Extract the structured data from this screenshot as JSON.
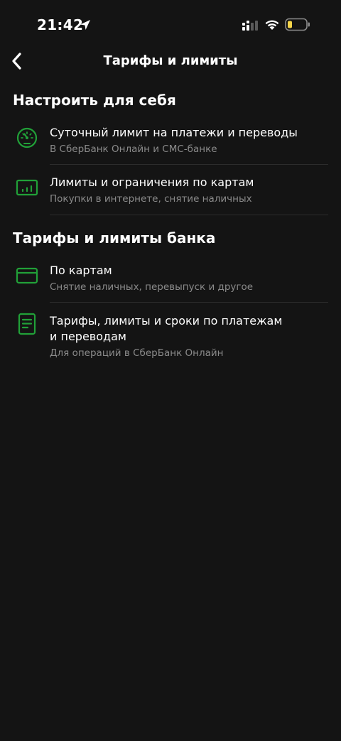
{
  "status_bar": {
    "time": "21:42",
    "icons": [
      "location-arrow-icon",
      "cellular-signal-icon",
      "wifi-icon",
      "battery-icon"
    ]
  },
  "header": {
    "title": "Тарифы и лимиты",
    "back_icon": "chevron-left-icon"
  },
  "sections": [
    {
      "heading": "Настроить для себя",
      "items": [
        {
          "icon": "speedometer-icon",
          "title": "Суточный лимит на платежи и переводы",
          "subtitle": "В СберБанк Онлайн и СМС-банке"
        },
        {
          "icon": "card-limits-icon",
          "title": "Лимиты и ограничения по картам",
          "subtitle": "Покупки в интернете, снятие наличных"
        }
      ]
    },
    {
      "heading": "Тарифы и лимиты банка",
      "items": [
        {
          "icon": "card-icon",
          "title": "По картам",
          "subtitle": "Снятие наличных, перевыпуск и другое"
        },
        {
          "icon": "document-icon",
          "title_line1": "Тарифы, лимиты и сроки по платежам",
          "title_line2": "и переводам",
          "subtitle": "Для операций в СберБанк Онлайн"
        }
      ]
    }
  ],
  "colors": {
    "background": "#141414",
    "accent_green": "#21A038",
    "text_primary": "#FFFFFF",
    "text_secondary": "#8A8A8A",
    "battery_low": "#F5D54A"
  }
}
